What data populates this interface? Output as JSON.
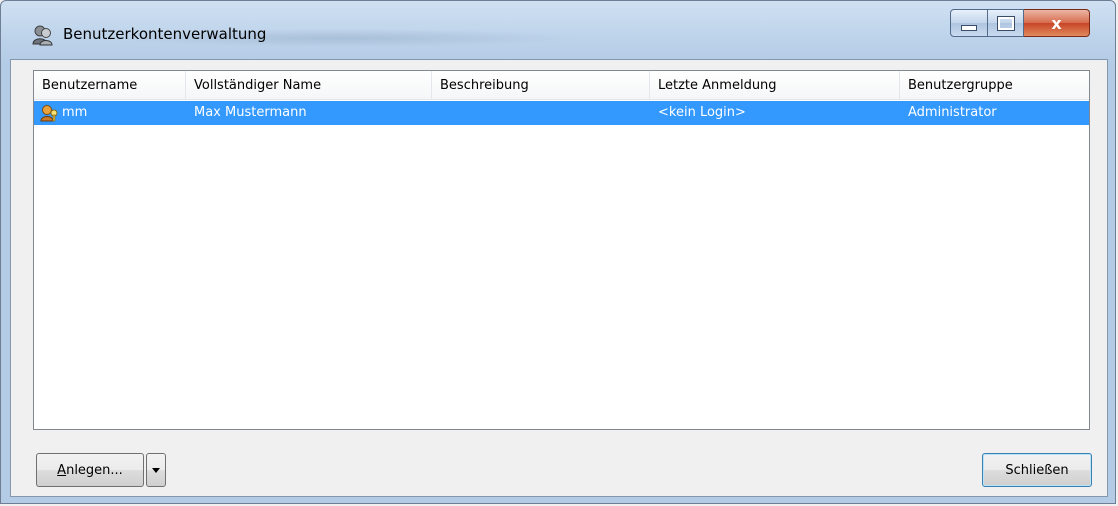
{
  "window": {
    "title": "Benutzerkontenverwaltung",
    "icon": "user-accounts-icon",
    "controls": {
      "minimize_icon": "minimize-icon",
      "maximize_icon": "maximize-icon",
      "close_label": "x"
    }
  },
  "list": {
    "columns": [
      {
        "label": "Benutzername"
      },
      {
        "label": "Vollständiger Name"
      },
      {
        "label": "Beschreibung"
      },
      {
        "label": "Letzte Anmeldung"
      },
      {
        "label": "Benutzergruppe"
      }
    ],
    "rows": [
      {
        "icon": "admin-user-icon",
        "username": "mm",
        "full_name": "Max Mustermann",
        "description": "",
        "last_login": "<kein Login>",
        "group": "Administrator",
        "selected": true
      }
    ]
  },
  "buttons": {
    "create_label_accel": "A",
    "create_label_rest": "nlegen...",
    "create_dropdown_icon": "chevron-down-icon",
    "close_label": "Schließen"
  },
  "colors": {
    "selection": "#3399ff",
    "close_button": "#c84526"
  }
}
